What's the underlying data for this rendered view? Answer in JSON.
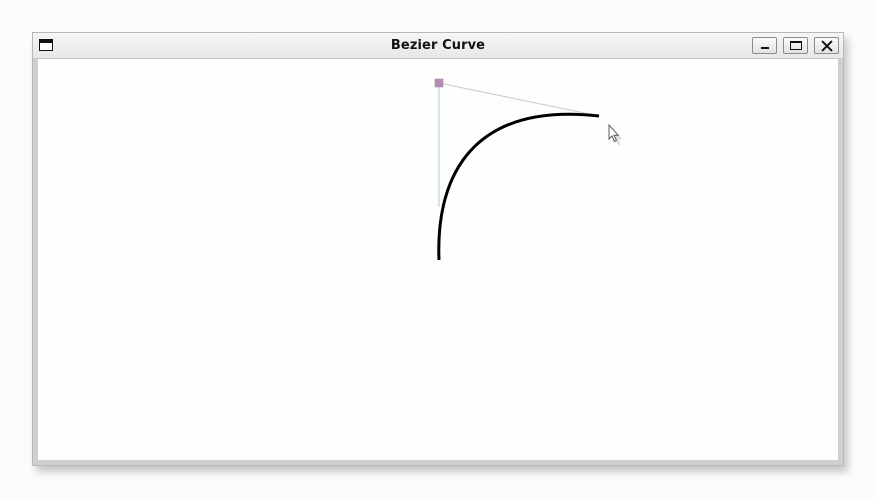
{
  "window": {
    "title": "Bezier Curve",
    "buttons": {
      "minimize": "minimize",
      "maximize": "maximize",
      "close": "close"
    }
  },
  "icons": {
    "system_menu": "window-menu-icon",
    "minimize": "minimize-icon",
    "maximize": "maximize-icon",
    "close": "close-icon",
    "cursor": "mouse-pointer-icon"
  },
  "colors": {
    "curve": "#000000",
    "control_point": "#b48cb4",
    "guide_line_vertical": "#a8d0c8",
    "guide_line_horizontal": "#c0d0c8",
    "canvas_background": "#fefefe"
  }
}
